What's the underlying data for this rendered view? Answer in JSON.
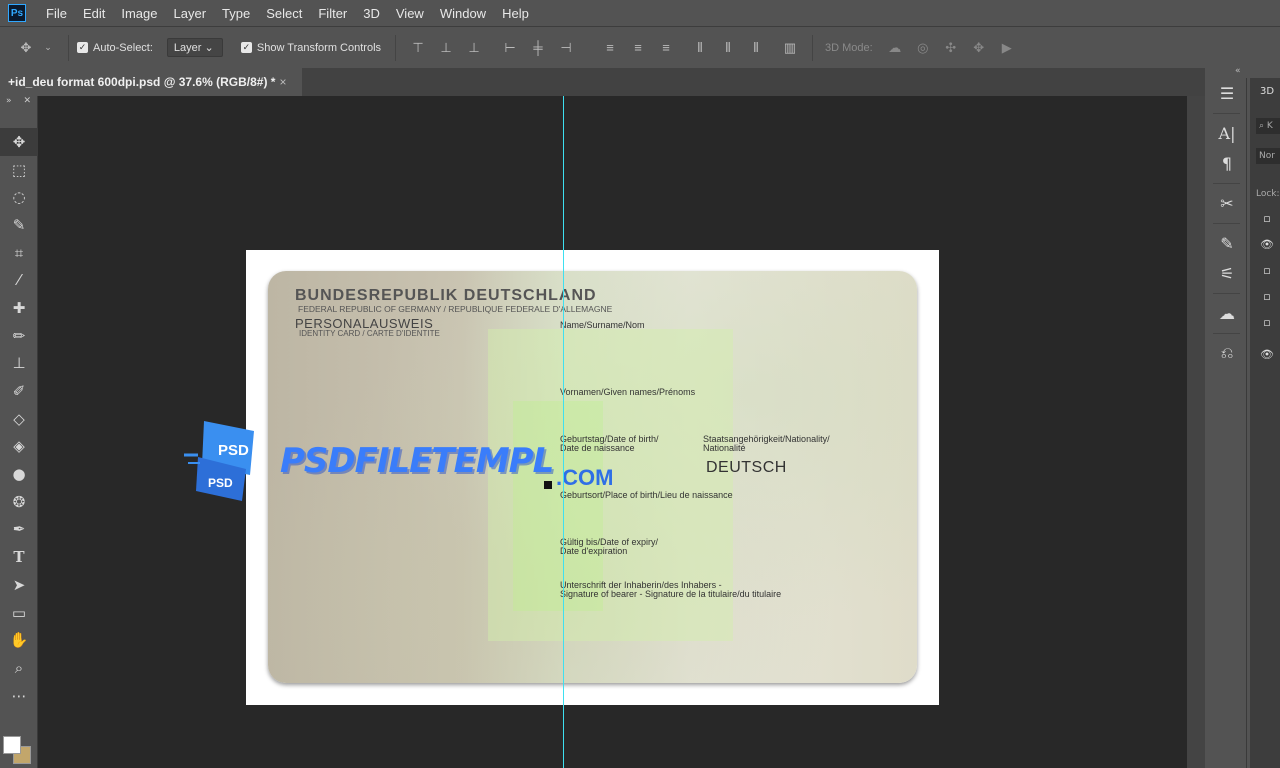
{
  "menu": [
    "File",
    "Edit",
    "Image",
    "Layer",
    "Type",
    "Select",
    "Filter",
    "3D",
    "View",
    "Window",
    "Help"
  ],
  "app_logo": "Ps",
  "options": {
    "auto_select_label": "Auto-Select:",
    "layer_select": "Layer",
    "show_transform_label": "Show Transform Controls",
    "mode_3d_label": "3D Mode:"
  },
  "tab": {
    "title": "+id_deu format 600dpi.psd @ 37.6% (RGB/8#) *",
    "close": "×"
  },
  "toolbox_head": {
    "collapse": "»",
    "close": "✕"
  },
  "card": {
    "title": "BUNDESREPUBLIK DEUTSCHLAND",
    "subtitle": "FEDERAL REPUBLIC OF GERMANY / REPUBLIQUE FEDERALE D'ALLEMAGNE",
    "personal": "PERSONALAUSWEIS",
    "idcard": "IDENTITY CARD / CARTE D'IDENTITE",
    "name_label": "Name/Surname/Nom",
    "given_label": "Vornamen/Given names/Prénoms",
    "dob_label_1": "Geburtstag/Date of birth/",
    "dob_label_2": "Date de naissance",
    "nat_label_1": "Staatsangehörigkeit/Nationality/",
    "nat_label_2": "Nationalité",
    "nationality": "DEUTSCH",
    "pob_label": "Geburtsort/Place of birth/Lieu de naissance",
    "exp_label_1": "Gültig bis/Date of expiry/",
    "exp_label_2": "Date d'expiration",
    "sig_label_1": "Unterschrift der Inhaberin/des Inhabers -",
    "sig_label_2": "Signature of bearer - Signature de la titulaire/du titulaire"
  },
  "watermark": {
    "logo_top": "PSD",
    "logo_bottom": "PSD",
    "text": "PSDFILETEMPL",
    "com": ".COM"
  },
  "panel": {
    "label_3d": "3D",
    "search": "⌕ K",
    "normal": "Nor",
    "lock": "Lock:"
  },
  "colors": {
    "accent": "#31a8ff",
    "guide": "#3ee0f0",
    "fg_swatch": "#ffffff",
    "bg_swatch": "#c2a66b"
  }
}
